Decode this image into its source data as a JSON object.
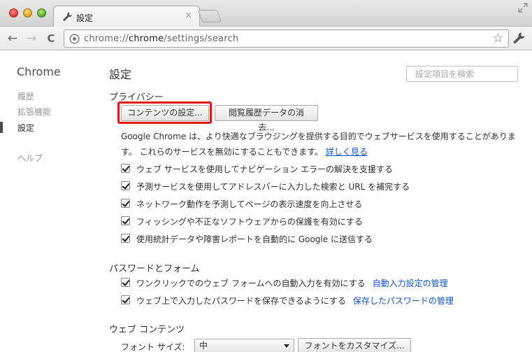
{
  "window": {
    "tab_title": "設定",
    "tab_close": "×",
    "url_scheme": "chrome://",
    "url_host": "chrome",
    "url_path": "/settings/search",
    "star_glyph": "☆",
    "back_glyph": "←",
    "forward_glyph": "→",
    "reload_glyph": "C"
  },
  "sidebar": {
    "brand": "Chrome",
    "items": [
      {
        "label": "履歴"
      },
      {
        "label": "拡張機能"
      },
      {
        "label": "設定"
      },
      {
        "label": "ヘルプ"
      }
    ]
  },
  "main": {
    "title": "設定",
    "search_placeholder": "設定項目を検索",
    "privacy": {
      "title": "プライバシー",
      "content_settings_button": "コンテンツの設定...",
      "clear_history_button": "閲覧履歴データの消去...",
      "description": "Google Chrome は、より快適なブラウジングを提供する目的でウェブサービスを使用することがあります。 これらのサービスを無効にすることもできます。",
      "learn_more": "詳しく見る",
      "checkboxes": [
        {
          "label": "ウェブ サービスを使用してナビゲーション エラーの解決を支援する",
          "checked": true
        },
        {
          "label": "予測サービスを使用してアドレスバーに入力した検索と URL を補完する",
          "checked": true
        },
        {
          "label": "ネットワーク動作を予測してページの表示速度を向上させる",
          "checked": true
        },
        {
          "label": "フィッシングや不正なソフトウェアからの保護を有効にする",
          "checked": true
        },
        {
          "label": "使用統計データや障害レポートを自動的に Google に送信する",
          "checked": true
        }
      ]
    },
    "passwords": {
      "title": "パスワードとフォーム",
      "checkboxes": [
        {
          "label": "ワンクリックでのウェブ フォームへの自動入力を有効にする",
          "link": "自動入力設定の管理",
          "checked": true
        },
        {
          "label": "ウェブ上で入力したパスワードを保存できるようにする",
          "link": "保存したパスワードの管理",
          "checked": true
        }
      ]
    },
    "web_content": {
      "title": "ウェブ コンテンツ",
      "font_size_label": "フォント サイズ:",
      "font_size_value": "中",
      "customize_fonts_button": "フォントをカスタマイズ..."
    }
  },
  "colors": {
    "highlight": "#e3161a",
    "link": "#1155cc"
  }
}
